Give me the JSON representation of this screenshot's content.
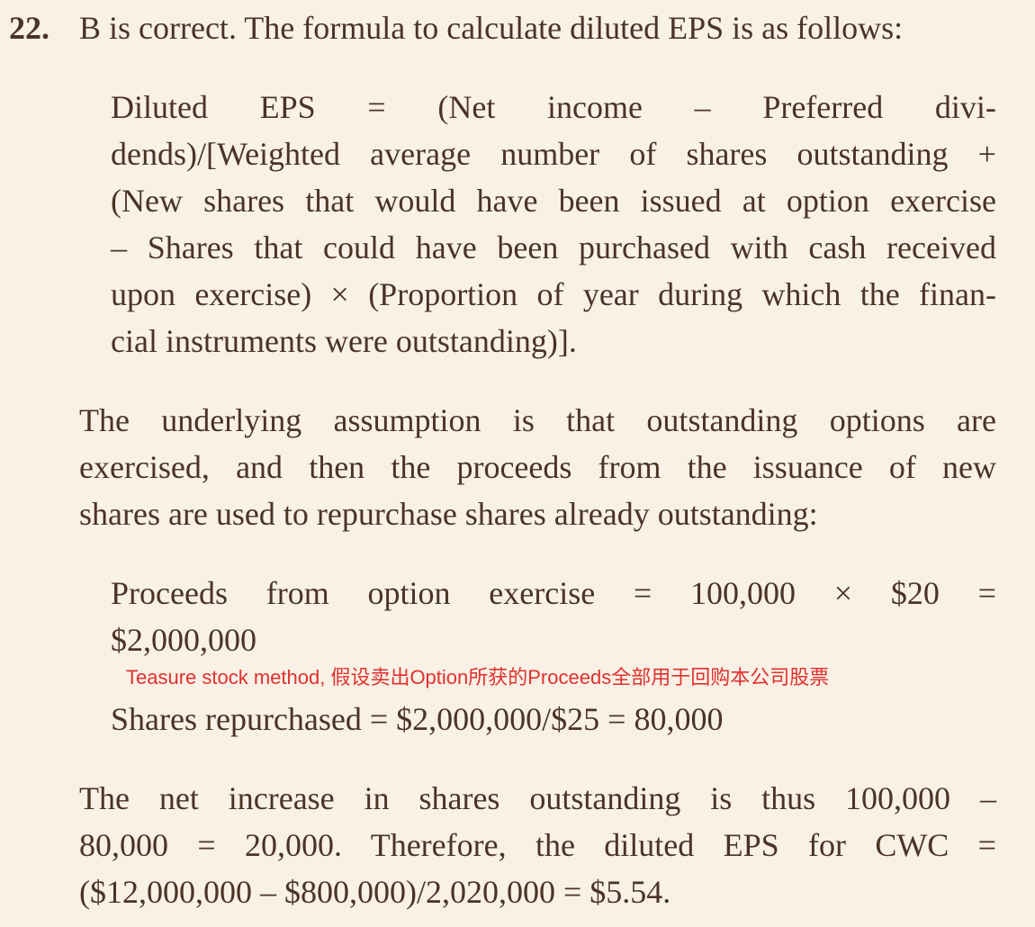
{
  "question": {
    "number": "22.",
    "intro": "B is correct. The formula to calculate diluted EPS is as follows:"
  },
  "formula": {
    "words_line1": [
      "Diluted",
      "EPS",
      "=",
      "(Net",
      "income",
      "–",
      "Preferred",
      "divi-"
    ],
    "line2": "dends)/[Weighted average number of shares outstanding +",
    "line3": "(New shares that would have been issued at option exercise",
    "line4": "– Shares that could have been purchased with cash received",
    "line5": "upon exercise) × (Proportion of year during which the finan-",
    "line6": "cial instruments were outstanding)]."
  },
  "assumption": {
    "line1": "The underlying assumption is that outstanding options are",
    "line2": "exercised, and then the proceeds from the issuance of new",
    "line3": "shares are used to repurchase shares already outstanding:"
  },
  "calc": {
    "proceeds_words": [
      "Proceeds",
      "from",
      "option",
      "exercise",
      "=",
      "100,000",
      "×",
      "$20",
      "="
    ],
    "proceeds_value": "$2,000,000",
    "annotation": "Teasure stock method, 假设卖出Option所获的Proceeds全部用于回购本公司股票",
    "shares_repurchased": "Shares repurchased = $2,000,000/$25 = 80,000"
  },
  "conclusion": {
    "line1": "The net increase in shares outstanding is thus 100,000 –",
    "line2": "80,000 = 20,000. Therefore, the diluted EPS for CWC =",
    "line3": "($12,000,000 – $800,000)/2,020,000 = $5.54."
  },
  "colors": {
    "background": "#faf1e6",
    "text": "#4a3426",
    "annotation": "#e0312f"
  }
}
